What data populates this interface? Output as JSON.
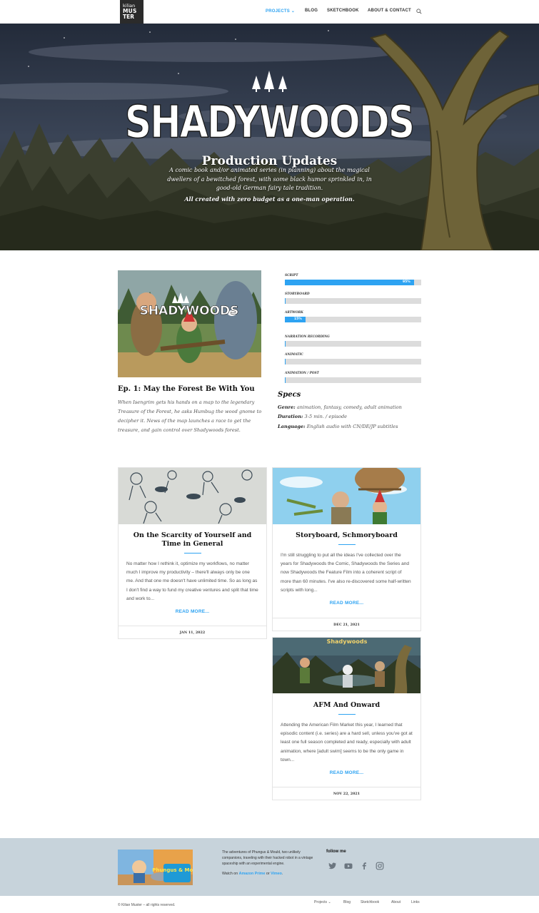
{
  "header": {
    "logo": {
      "line1": "kilian",
      "line2": "MUS",
      "line3": "TER"
    },
    "nav": [
      {
        "label": "PROJECTS",
        "caret": "⌄"
      },
      {
        "label": "BLOG"
      },
      {
        "label": "SKETCHBOOK"
      },
      {
        "label": "ABOUT & CONTACT"
      }
    ],
    "accent": "#2ea3f2"
  },
  "hero": {
    "logo_text": "SHADYWOODS",
    "title": "Production Updates",
    "description": "A comic book and/or animated series (in planning) about the magical dwellers of a bewitched forest, with some black humor sprinkled in, in good-old German fairy tale tradition.",
    "strong": "All created with zero budget as a one-man operation."
  },
  "episode": {
    "image_logo": "SHADYWOODS",
    "title": "Ep. 1: May the Forest Be With You",
    "description": "When Isengrim gets his hands on a map to the legendary Treasure of the Forest, he asks Humbug the wood gnome to decipher it. News of the map launches a race to get the treasure, and gain control over Shadywoods forest."
  },
  "progress": [
    {
      "label": "SCRIPT",
      "percent": 95,
      "text": "95%"
    },
    {
      "label": "STORYBOARD",
      "percent": 0,
      "text": ""
    },
    {
      "label": "ARTWORK",
      "percent": 15,
      "text": "15%"
    },
    {
      "label": "NARRATION RECORDING",
      "percent": 0,
      "text": ""
    },
    {
      "label": "ANIMATIC",
      "percent": 0,
      "text": ""
    },
    {
      "label": "ANIMATION / POST",
      "percent": 0,
      "text": ""
    }
  ],
  "specs": {
    "title": "Specs",
    "rows": [
      {
        "key": "Genre:",
        "value": "animation, fantasy, comedy, adult animation"
      },
      {
        "key": "Duration:",
        "value": "3-5 min. / episode"
      },
      {
        "key": "Language:",
        "value": "English audio with CN/DE/JP subtitles"
      }
    ]
  },
  "posts": [
    {
      "title": "On the Scarcity of Yourself and Time in General",
      "excerpt": "No matter how I rethink it, optimize my workflows, no matter much I improve my productivity – there'll always only be one me. And that one me doesn't have unlimited time. So as long as I don't find a way to fund my creative ventures and split that time and work to...",
      "more": "READ MORE...",
      "date": "JAN 11, 2022"
    },
    {
      "title": "Storyboard, Schmoryboard",
      "excerpt": "I'm still struggling to put all the ideas I've collected over the years for Shadywoods the Comic, Shadywoods the Series and now Shadywoods the Feature Film into a coherent script of more than 60 minutes. I've also re-discovered some half-written scripts with long...",
      "more": "READ MORE...",
      "date": "DEC 21, 2021"
    },
    {
      "title": "AFM And Onward",
      "excerpt": "Attending the American Film Market this year, I learned that episodic content (i.e. series) are a hard sell, unless you've got at least one full season completed and ready, especially with adult animation, where [adult swim] seems to be the only game in town...",
      "more": "READ MORE...",
      "date": "NOV 22, 2021",
      "image_text": "Shadywoods"
    }
  ],
  "footer": {
    "image_text": "Phungus & Mould",
    "text": "The adventures of Phungus & Mould, two unlikely companions, traveling with their hacked robot in a vintage spaceship with an experimental engine.",
    "watch_prefix": "Watch on ",
    "watch_link1": "Amazon Prime",
    "watch_mid": " or ",
    "watch_link2": "Vimeo",
    "watch_suffix": ".",
    "follow": "follow me",
    "social": [
      "twitter-icon",
      "youtube-icon",
      "facebook-icon",
      "instagram-icon"
    ],
    "copyright": "© Kilian Muster – all rights reserved.",
    "bottom_nav": [
      {
        "label": "Projects",
        "caret": "⌄"
      },
      {
        "label": "Blog"
      },
      {
        "label": "Sketchbook"
      },
      {
        "label": "About"
      },
      {
        "label": "Links"
      }
    ]
  }
}
